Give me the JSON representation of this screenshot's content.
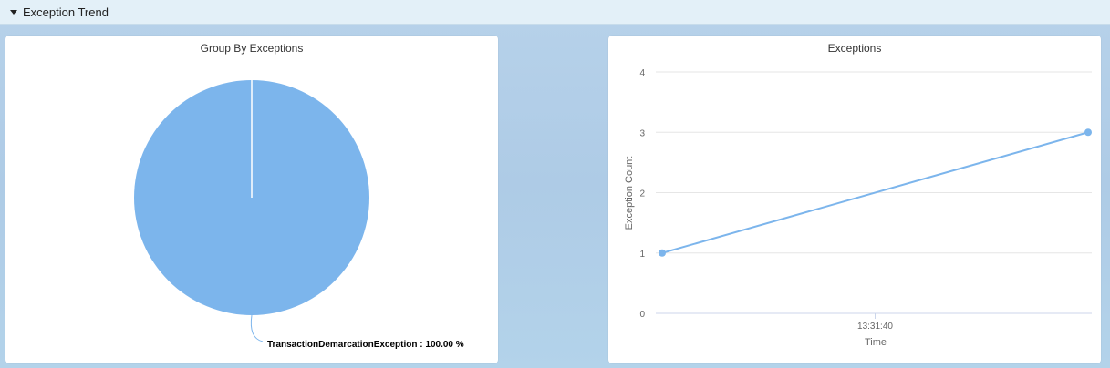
{
  "section": {
    "title": "Exception Trend"
  },
  "pie_panel": {
    "title": "Group By Exceptions"
  },
  "line_panel": {
    "title": "Exceptions"
  },
  "colors": {
    "series": "#7cb5ec",
    "grid": "#e6e6e6",
    "header_bg": "#e3f0f8"
  },
  "chart_data": [
    {
      "type": "pie",
      "title": "Group By Exceptions",
      "slices": [
        {
          "label": "TransactionDemarcationException : 100.00 %",
          "name": "TransactionDemarcationException",
          "value": 100.0
        }
      ]
    },
    {
      "type": "line",
      "title": "Exceptions",
      "xlabel": "Time",
      "ylabel": "Exception Count",
      "x_tick_labels": [
        "13:31:40"
      ],
      "ylim": [
        0,
        4
      ],
      "yticks": [
        0,
        1,
        2,
        3,
        4
      ],
      "grid": true,
      "series": [
        {
          "values": [
            1,
            3
          ]
        }
      ]
    }
  ]
}
